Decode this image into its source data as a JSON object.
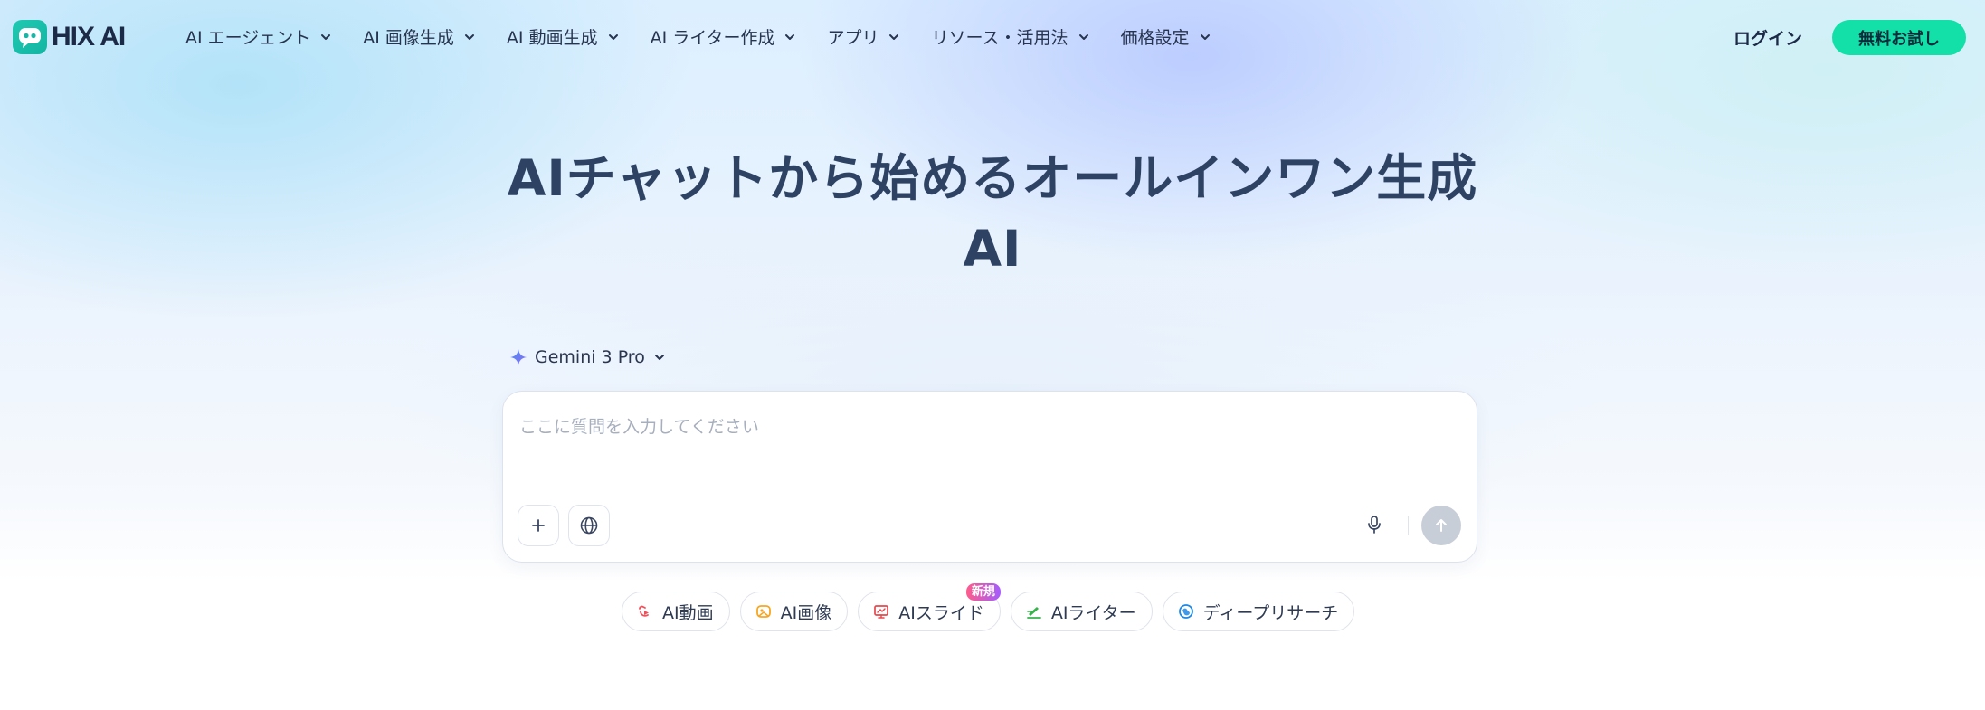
{
  "brand": {
    "name": "HIX AI",
    "accent": "#12e0a8",
    "logo_color": "#1fc4ad"
  },
  "nav": {
    "items": [
      {
        "label": "AI エージェント",
        "icon": "chevron-down-icon"
      },
      {
        "label": "AI 画像生成",
        "icon": "chevron-down-icon"
      },
      {
        "label": "AI 動画生成",
        "icon": "chevron-down-icon"
      },
      {
        "label": "AI ライター作成",
        "icon": "chevron-down-icon"
      },
      {
        "label": "アプリ",
        "icon": "chevron-down-icon"
      },
      {
        "label": "リソース・活用法",
        "icon": "chevron-down-icon"
      },
      {
        "label": "価格設定",
        "icon": "chevron-down-icon"
      }
    ],
    "login_label": "ログイン",
    "trial_label": "無料お試し"
  },
  "hero": {
    "title_line1": "AIチャットから始めるオールインワン生成",
    "title_line2": "AI"
  },
  "chat": {
    "model_name": "Gemini 3 Pro",
    "model_icon": "sparkle-icon",
    "placeholder": "ここに質問を入力してください",
    "value": "",
    "send_color": "#c8ced8"
  },
  "chips": [
    {
      "label": "AI動画",
      "icon": "video-icon",
      "color": "#f0505a"
    },
    {
      "label": "AI画像",
      "icon": "image-icon",
      "color": "#f5a623"
    },
    {
      "label": "AIスライド",
      "icon": "slide-icon",
      "color": "#e5484d",
      "badge": "新規"
    },
    {
      "label": "AIライター",
      "icon": "pen-icon",
      "color": "#36b24a"
    },
    {
      "label": "ディープリサーチ",
      "icon": "research-icon",
      "color": "#1e88e5"
    }
  ]
}
